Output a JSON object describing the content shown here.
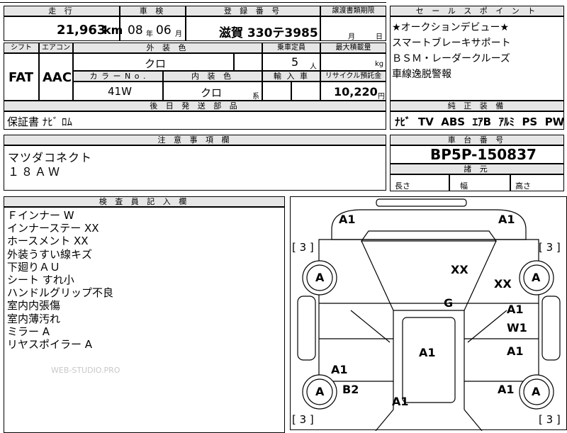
{
  "top_table": {
    "headers": {
      "mileage": "走 行",
      "inspection": "車 検",
      "registration": "登 録 番 号",
      "transfer_deadline": "譲渡書類期限"
    },
    "mileage_value": "21,963",
    "mileage_unit": "km",
    "inspection_year": "08",
    "inspection_year_unit": "年",
    "inspection_month": "06",
    "inspection_month_unit": "月",
    "registration_value": "滋賀 330テ3985",
    "transfer_month_unit": "月",
    "transfer_day_unit": "日"
  },
  "spec_table": {
    "shift_header": "シフト",
    "aircon_header": "エアコン",
    "exterior_color_header": "外 装 色",
    "capacity_header": "乗車定員",
    "max_load_header": "最大積載量",
    "shift_value": "FAT",
    "aircon_value": "AAC",
    "exterior_color_value": "クロ",
    "capacity_value": "5",
    "capacity_unit": "人",
    "max_load_unit": "kg",
    "color_no_header": "カ ラ ー N o .",
    "interior_color_header": "内 装 色",
    "import_header": "輸 入 車",
    "recycle_header": "リサイクル預託金",
    "color_no_value": "41W",
    "interior_color_value": "クロ",
    "interior_color_suffix": "系",
    "recycle_value": "10,220",
    "recycle_unit": "円"
  },
  "later_parts": {
    "header": "後 日 発 送 部 品",
    "value": "保証書 ﾅﾋﾞ ﾛﾑ"
  },
  "notes": {
    "header": "注 意 事 項 欄",
    "lines": [
      "マツダコネクト",
      "１８ＡＷ"
    ]
  },
  "inspector": {
    "header": "検 査 員 記 入 欄",
    "lines": [
      "Ｆインナー W",
      "インナーステー XX",
      "ホースメント XX",
      "外装うすい線キズ",
      "下廻りＡＵ",
      "シート すれ小",
      "ハンドルグリップ不良",
      "室内内張傷",
      "室内薄汚れ",
      "ミラー A",
      "リヤスポイラー A"
    ],
    "watermark": "WEB-STUDIO.PRO"
  },
  "sales_points": {
    "header": "セ ー ル ス ポ イ ン ト",
    "lines": [
      "★オークションデビュー★",
      "スマートブレーキサポート",
      "ＢＳＭ・レーダークルーズ",
      "車線逸脱警報"
    ]
  },
  "equipment": {
    "header": "純 正 装 備",
    "items": [
      "ﾅﾋﾞ",
      "TV",
      "ABS",
      "ｴｱB",
      "ｱﾙﾐ",
      "PS",
      "PW"
    ]
  },
  "chassis": {
    "header": "車 台 番 号",
    "value": "BP5P-150837"
  },
  "dimensions": {
    "header": "諸 元",
    "length_label": "長さ",
    "width_label": "幅",
    "height_label": "高さ"
  },
  "car_map": {
    "tires": [
      "[ 3 ]",
      "[ 3 ]",
      "[ 3 ]",
      "[ 3 ]"
    ],
    "wheel_marks": [
      "A",
      "A",
      "A",
      "A"
    ],
    "marks": {
      "front_left": "A1",
      "front_right": "A1",
      "hood": "XX",
      "fender_right": "XX",
      "windshield": "G",
      "front_door_right": "A1",
      "front_door_right2": "W1",
      "rear_door_right": "A1",
      "roof": "A1",
      "rear_door_left": "A1",
      "quarter_left": "B2",
      "quarter_right": "A1",
      "trunk": "A1"
    }
  }
}
